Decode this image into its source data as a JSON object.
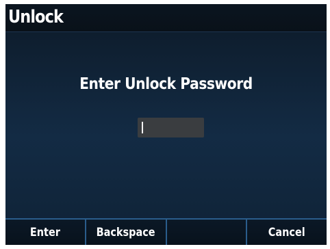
{
  "window": {
    "title": "Unlock"
  },
  "main": {
    "prompt": "Enter Unlock Password",
    "password_value": ""
  },
  "softkeys": [
    {
      "label": "Enter"
    },
    {
      "label": "Backspace"
    },
    {
      "label": ""
    },
    {
      "label": "Cancel"
    }
  ],
  "colors": {
    "background": "#132b44",
    "titlebar": "#0b1520",
    "field": "#3a3d40",
    "divider": "#2a5d8c",
    "text": "#ffffff"
  }
}
